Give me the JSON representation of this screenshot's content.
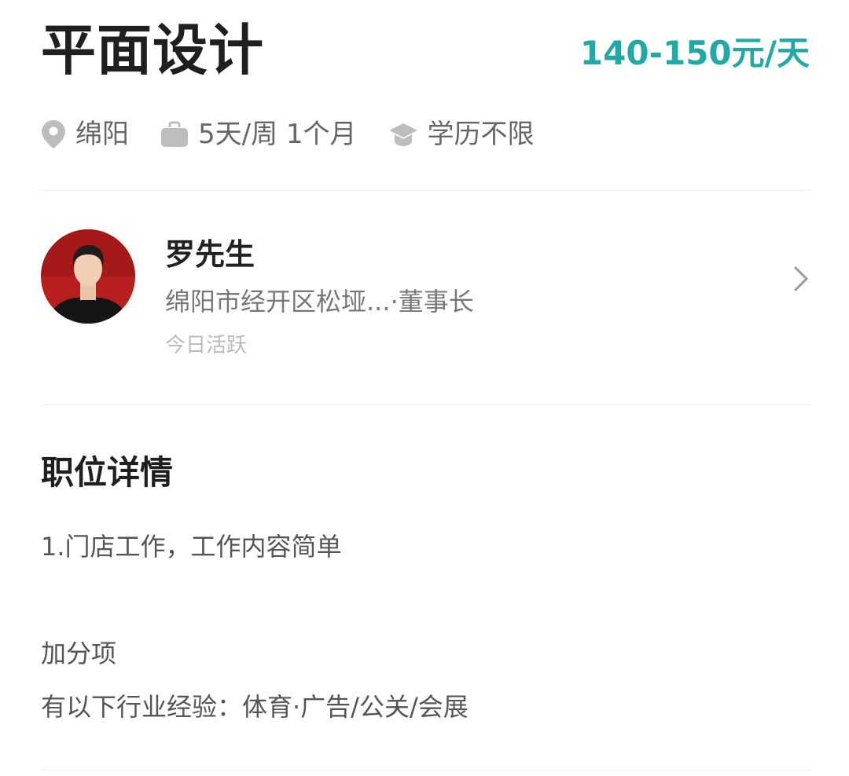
{
  "job": {
    "title": "平面设计",
    "salary": "140-150元/天"
  },
  "meta": {
    "location": "绵阳",
    "schedule": "5天/周 1个月",
    "education": "学历不限",
    "icons": [
      "location-pin-icon",
      "briefcase-icon",
      "graduation-cap-icon"
    ]
  },
  "employer": {
    "name": "罗先生",
    "company_role": "绵阳市经开区松垭...·董事长",
    "active_status": "今日活跃"
  },
  "details": {
    "section_title": "职位详情",
    "line1": "1.门店工作，工作内容简单",
    "bonus_heading": "加分项",
    "bonus_line": "有以下行业经验：体育·广告/公关/会展"
  },
  "colors": {
    "accent": "#21a9a5",
    "meta_icon": "#bdbdbd"
  }
}
